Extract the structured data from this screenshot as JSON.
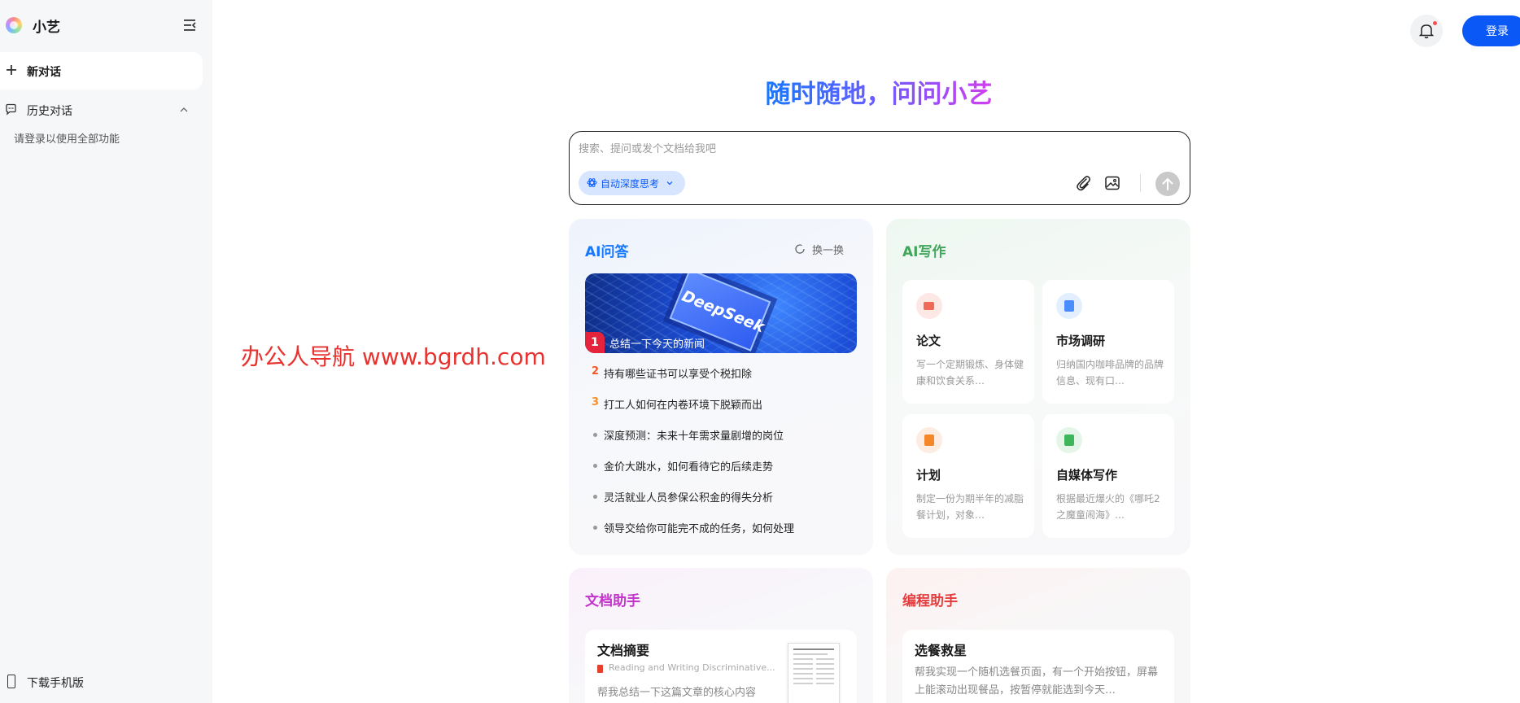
{
  "sidebar": {
    "app_name": "小艺",
    "new_chat_label": "新对话",
    "history_label": "历史对话",
    "login_hint": "请登录以使用全部功能",
    "download_label": "下载手机版"
  },
  "header": {
    "login_label": "登录"
  },
  "hero": {
    "title": "随时随地，问问小艺"
  },
  "input": {
    "placeholder": "搜索、提问或发个文档给我吧",
    "deep_think_label": "自动深度思考"
  },
  "qa": {
    "title": "AI问答",
    "refresh_label": "换一换",
    "banner_image_text": "DeepSeek",
    "top_number": "1",
    "top_item": "总结一下今天的新闻",
    "items": [
      {
        "num": "2",
        "text": "持有哪些证书可以享受个税扣除"
      },
      {
        "num": "3",
        "text": "打工人如何在内卷环境下脱颖而出"
      },
      {
        "num": "",
        "text": "深度预测：未来十年需求量剧增的岗位"
      },
      {
        "num": "",
        "text": "金价大跳水，如何看待它的后续走势"
      },
      {
        "num": "",
        "text": "灵活就业人员参保公积金的得失分析"
      },
      {
        "num": "",
        "text": "领导交给你可能完不成的任务，如何处理"
      }
    ]
  },
  "writing": {
    "title": "AI写作",
    "tiles": [
      {
        "name": "论文",
        "desc": "写一个定期锻炼、身体健康和饮食关系…"
      },
      {
        "name": "市场调研",
        "desc": "归纳国内咖啡品牌的品牌信息、现有口…"
      },
      {
        "name": "计划",
        "desc": "制定一份为期半年的减脂餐计划，对象…"
      },
      {
        "name": "自媒体写作",
        "desc": "根据最近爆火的《哪吒2之魔童闹海》…"
      }
    ]
  },
  "doc_assistant": {
    "title": "文档助手",
    "tile_name": "文档摘要",
    "file_name": "Reading and Writing Discriminative...",
    "desc": "帮我总结一下这篇文章的核心内容"
  },
  "code_assistant": {
    "title": "编程助手",
    "tile_name": "选餐救星",
    "desc": "帮我实现一个随机选餐页面，有一个开始按钮，屏幕上能滚动出现餐品，按暂停就能选到今天…"
  },
  "watermark": "办公人导航 www.bgrdh.com",
  "colors": {
    "accent": "#0a59f7",
    "qa_title": "#1677ff",
    "write_title": "#3fa65a",
    "doc_title": "#c234c9",
    "code_title": "#e43d3d",
    "rank1": "#e5233d",
    "rank2": "#f05a28",
    "rank3": "#f5912b"
  },
  "icons": {
    "new_chat": "plus-icon",
    "history": "chat-bubble-icon",
    "collapse": "sidebar-collapse-icon",
    "bell": "bell-icon",
    "attach": "paperclip-icon",
    "image": "image-icon",
    "send": "arrow-up-icon",
    "refresh": "refresh-icon",
    "download": "phone-icon"
  }
}
